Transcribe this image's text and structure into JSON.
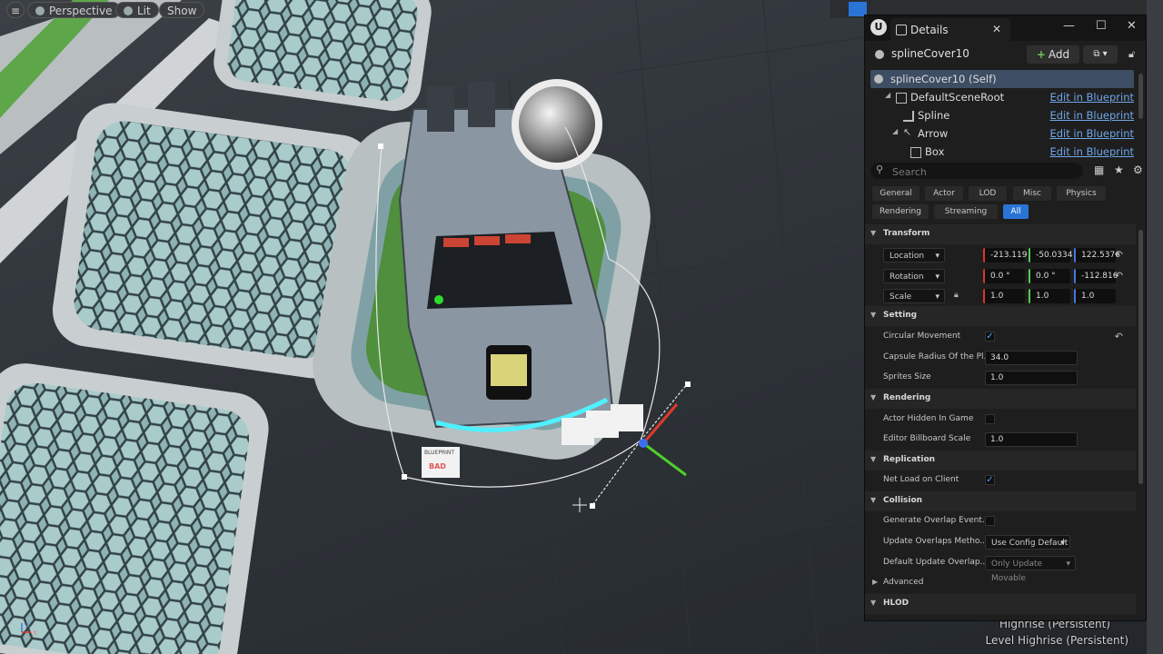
{
  "viewport": {
    "mode_label": "Perspective",
    "lighting_label": "Lit",
    "show_label": "Show",
    "outliner_lines": [
      "Highrise (Persistent)",
      "Level  Highrise (Persistent)"
    ],
    "decals": [
      "BLUEPRINT",
      "BAD"
    ]
  },
  "details": {
    "tab_title": "Details",
    "tab_close": "✕",
    "window_min": "—",
    "window_max": "☐",
    "window_close": "✕",
    "object_name": "splineCover10",
    "add_label": "Add",
    "components": [
      {
        "name": "splineCover10 (Self)",
        "selected": true,
        "link": ""
      },
      {
        "name": "DefaultSceneRoot",
        "selected": false,
        "link": "Edit in Blueprint"
      },
      {
        "name": "Spline",
        "selected": false,
        "link": "Edit in Blueprint"
      },
      {
        "name": "Arrow",
        "selected": false,
        "link": "Edit in Blueprint"
      },
      {
        "name": "Box",
        "selected": false,
        "link": "Edit in Blueprint"
      }
    ],
    "search_placeholder": "Search",
    "categories": [
      "General",
      "Actor",
      "LOD",
      "Misc",
      "Physics",
      "Rendering",
      "Streaming",
      "All"
    ],
    "active_category": "All",
    "transform": {
      "title": "Transform",
      "location": {
        "label": "Location",
        "x": "-213.119",
        "y": "-50.0334",
        "z": "122.5376"
      },
      "rotation": {
        "label": "Rotation",
        "x": "0.0 °",
        "y": "0.0 °",
        "z": "-112.816"
      },
      "scale": {
        "label": "Scale",
        "x": "1.0",
        "y": "1.0",
        "z": "1.0"
      }
    },
    "setting": {
      "title": "Setting",
      "circular_movement": "Circular Movement",
      "circular_checked": true,
      "capsule_radius_label": "Capsule Radius Of the Pl...",
      "capsule_radius_value": "34.0",
      "sprites_size_label": "Sprites Size",
      "sprites_size_value": "1.0"
    },
    "rendering": {
      "title": "Rendering",
      "actor_hidden": "Actor Hidden In Game",
      "actor_hidden_checked": false,
      "billboard_label": "Editor Billboard Scale",
      "billboard_value": "1.0"
    },
    "replication": {
      "title": "Replication",
      "net_load": "Net Load on Client",
      "net_load_checked": true
    },
    "collision": {
      "title": "Collision",
      "gen_overlap": "Generate Overlap Event...",
      "gen_overlap_checked": false,
      "update_overlaps_label": "Update Overlaps Metho...",
      "update_overlaps_value": "Use Config Default",
      "default_update_label": "Default Update Overlap...",
      "default_update_value": "Only Update Movable"
    },
    "advanced_title": "Advanced",
    "hlod_title": "HLOD"
  },
  "colors": {
    "accent": "#2a74d6",
    "link": "#6fa6e8",
    "selection": "#3d4d63",
    "glow": "#4ff0ff"
  }
}
